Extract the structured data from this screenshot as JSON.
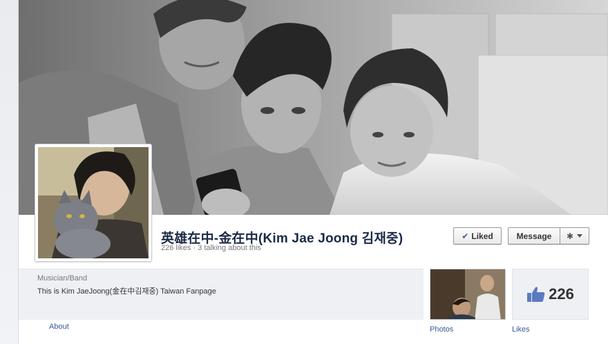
{
  "page": {
    "name": "英雄在中-金在中(Kim Jae Joong 김재중)",
    "stats": "226 likes · 3 talking about this",
    "category": "Musician/Band",
    "description": "This is Kim JaeJoong(金在中김재중) Taiwan Fanpage"
  },
  "actions": {
    "liked_label": "Liked",
    "message_label": "Message"
  },
  "tabs": {
    "about_label": "About",
    "photos_label": "Photos",
    "likes_label": "Likes",
    "likes_count": "226"
  },
  "icons": {
    "liked": "checkmark-icon",
    "settings": "gear-icon",
    "dropdown": "caret-down-icon",
    "likes": "thumbs-up-icon"
  },
  "colors": {
    "link": "#3b5998",
    "name": "#1c2a47",
    "panel": "#eef0f4"
  }
}
